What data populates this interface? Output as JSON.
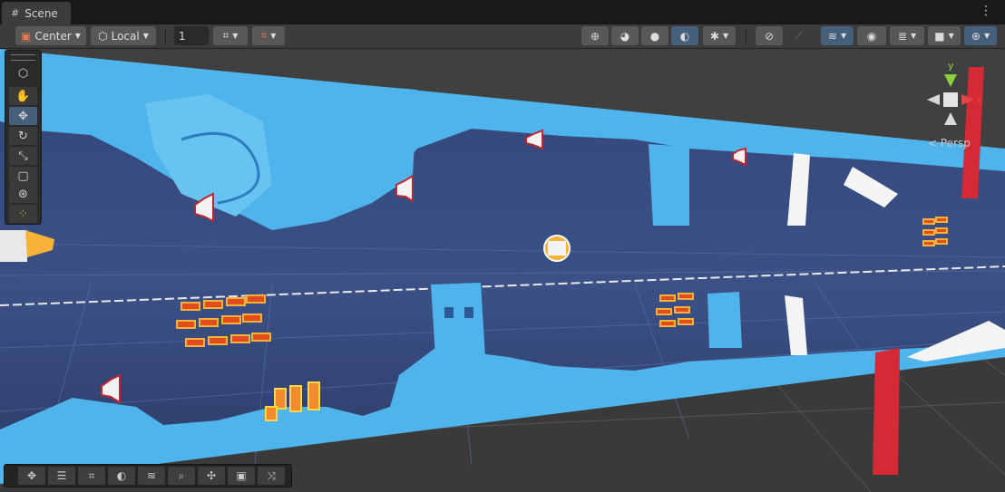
{
  "window": {
    "tab_title": "Scene",
    "tab_icon": "grid-icon",
    "menu_icon": "kebab-menu-icon"
  },
  "toolbar": {
    "pivot_label": "Center",
    "space_label": "Local",
    "grid_value": "1",
    "right_icons": [
      "wireframe-sphere-icon",
      "shaded-sphere-icon",
      "solid-sphere-icon",
      "lit-sphere-icon",
      "bug-icon",
      "fx-off-icon",
      "fx-icon",
      "layers-icon",
      "visibility-eye-icon",
      "draw-mode-icon",
      "camera-icon",
      "gizmos-icon"
    ]
  },
  "tools": [
    "view-cube-icon",
    "hand-icon",
    "move-icon",
    "rotate-icon",
    "scale-icon",
    "rect-icon",
    "transform-icon",
    "custom-tool-icon"
  ],
  "gizmo": {
    "projection_label": "< Persp",
    "y_axis": "y",
    "x_axis": "x"
  },
  "overlay_tools": [
    "move-icon",
    "sliders-icon",
    "grid-lines-icon",
    "sphere-icon",
    "layers-icon",
    "zoom-icon",
    "pan-icon",
    "camera-swap-icon",
    "shuffle-icon"
  ],
  "colors": {
    "accent": "#46607c",
    "toolbar": "#3c3c3c",
    "scene_bg": "#2f3f6d",
    "tile_blue": "#4fb4ec"
  }
}
